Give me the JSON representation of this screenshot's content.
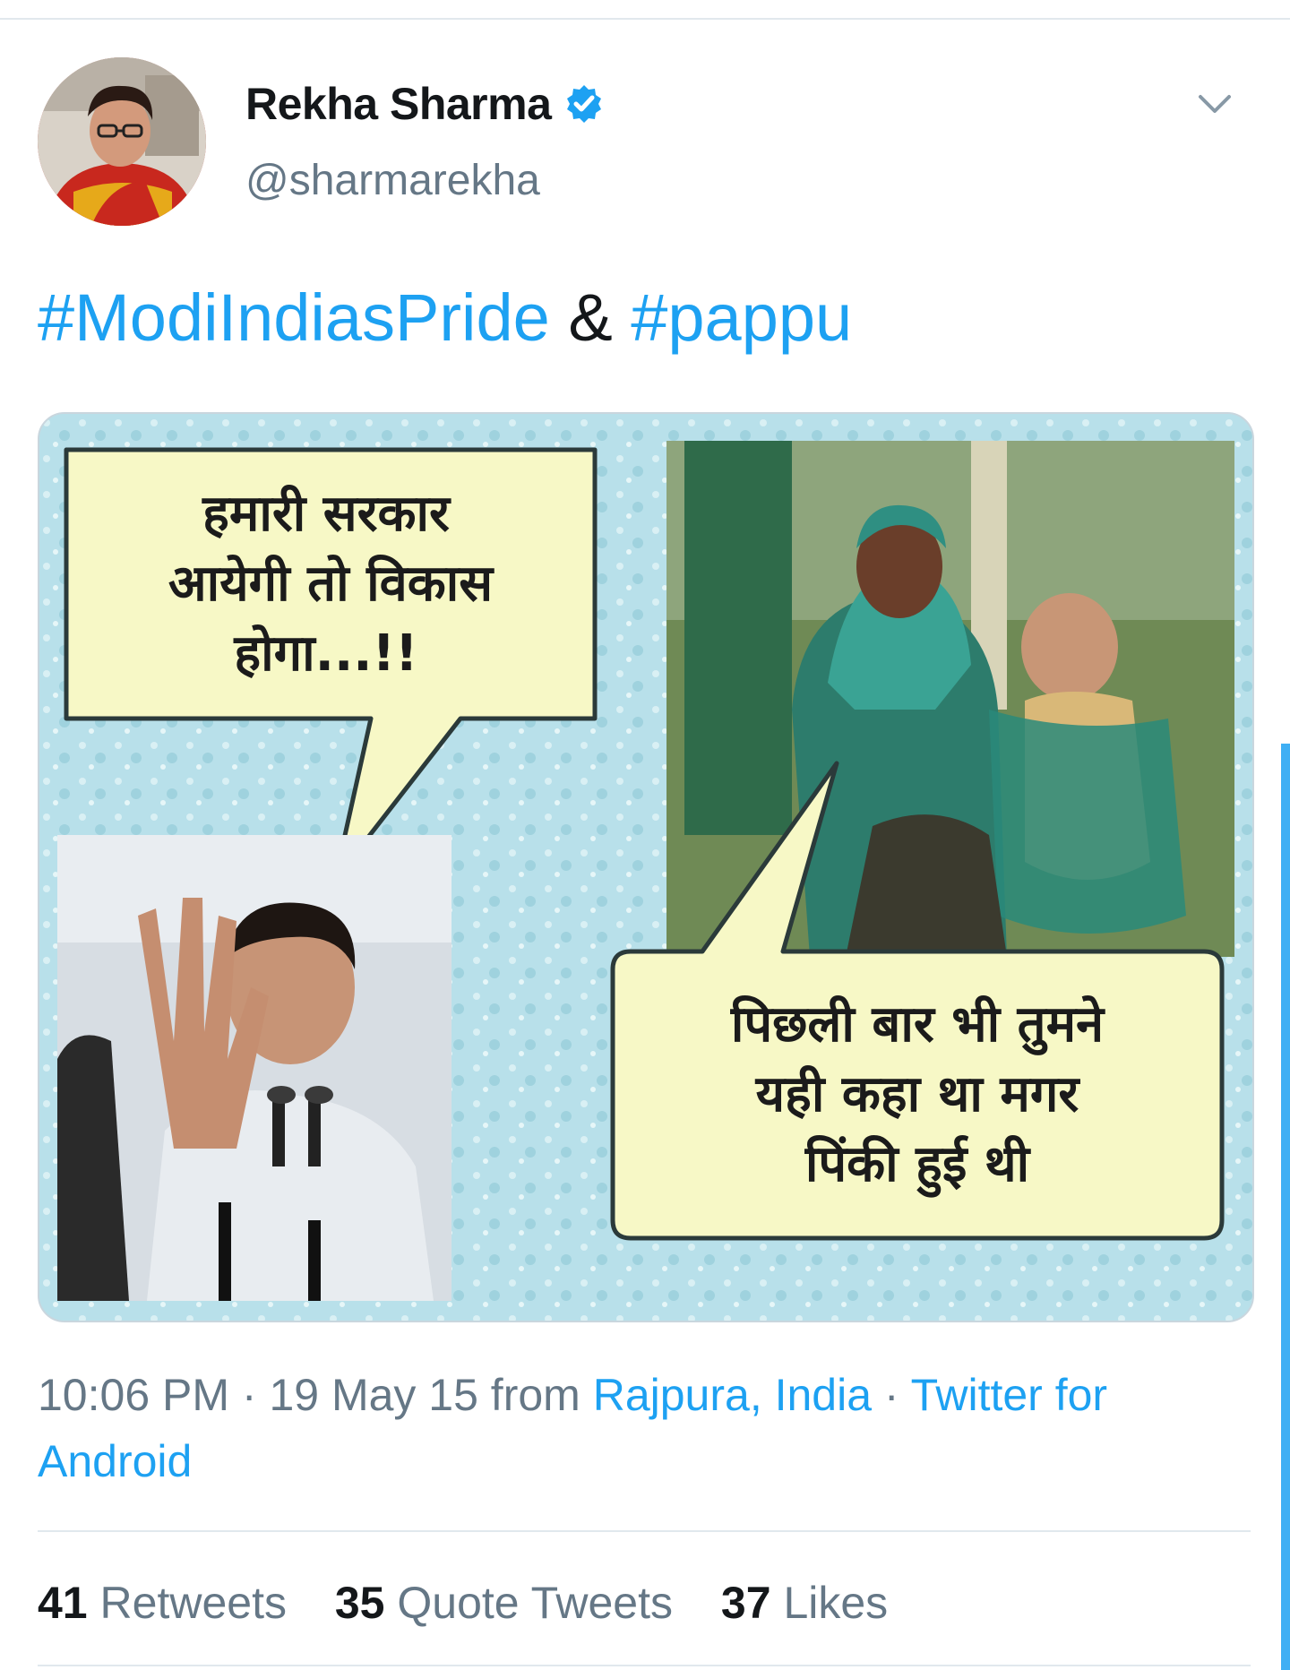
{
  "user": {
    "display_name": "Rekha Sharma",
    "handle": "@sharmarekha",
    "verified": true
  },
  "tweet": {
    "hashtag_1": "#ModiIndiasPride",
    "connector": "&",
    "hashtag_2": "#pappu"
  },
  "media": {
    "bubble_left_line1": "हमारी सरकार",
    "bubble_left_line2": "आयेगी तो विकास",
    "bubble_left_line3": "होगा...!!",
    "bubble_right_line1": "पिछली बार भी तुमने",
    "bubble_right_line2": "यही कहा था मगर",
    "bubble_right_line3": "पिंकी हुई थी"
  },
  "meta": {
    "time_date": "10:06 PM · 19 May 15 from",
    "location": "Rajpura, India",
    "separator": " · ",
    "source": "Twitter for Android"
  },
  "stats": {
    "retweets_count": "41",
    "retweets_label": "Retweets",
    "quotes_count": "35",
    "quotes_label": "Quote Tweets",
    "likes_count": "37",
    "likes_label": "Likes"
  },
  "colors": {
    "accent": "#1da1f2",
    "secondary_text": "#657786",
    "primary_text": "#14171a"
  },
  "icons": [
    "verified-badge-icon",
    "chevron-down-icon"
  ]
}
